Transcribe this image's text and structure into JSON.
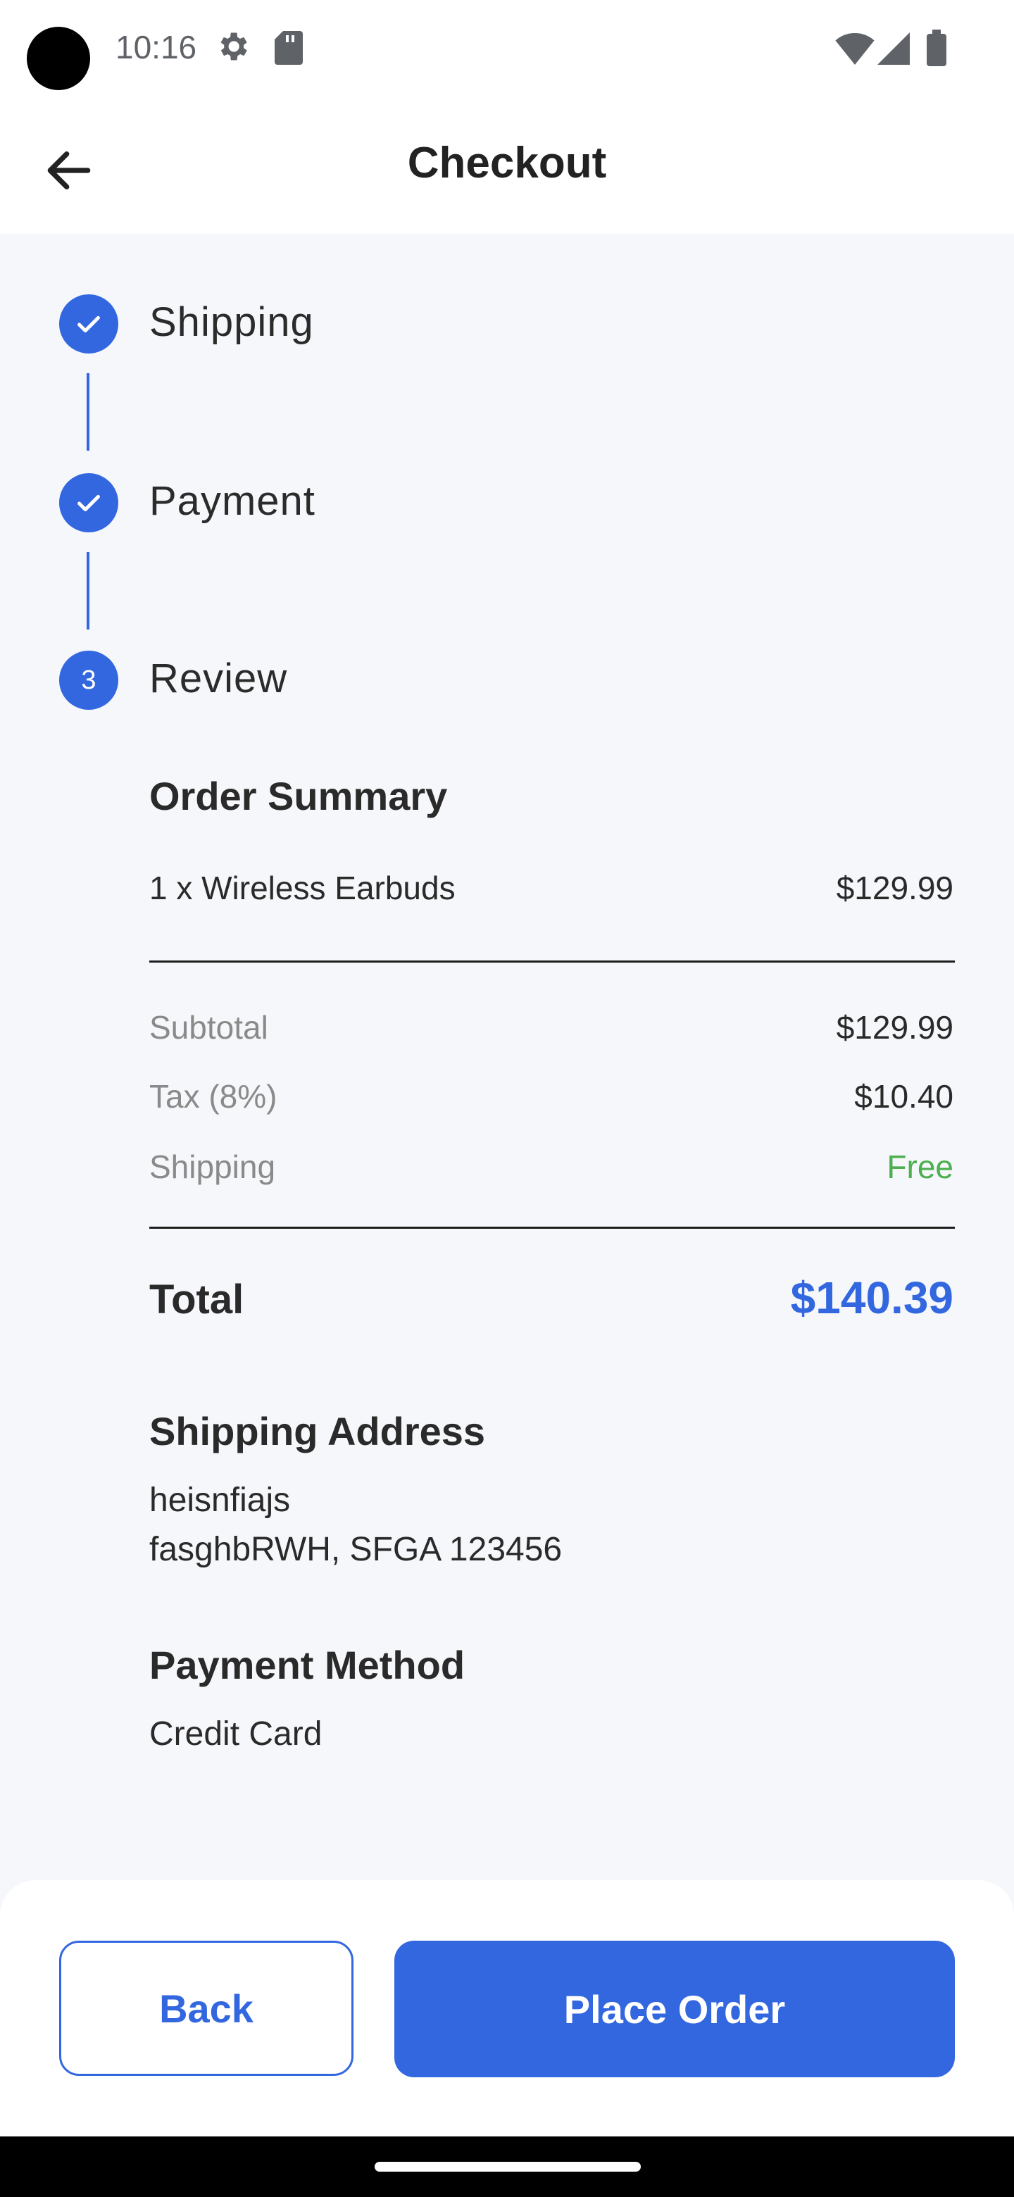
{
  "status_bar": {
    "time": "10:16",
    "icons": [
      "gear-icon",
      "sd-card-icon",
      "wifi-icon",
      "signal-icon",
      "battery-icon"
    ]
  },
  "app_bar": {
    "title": "Checkout",
    "back_icon": "arrow-left-icon"
  },
  "stepper": {
    "steps": [
      {
        "label": "Shipping",
        "state": "completed",
        "icon": "check-icon"
      },
      {
        "label": "Payment",
        "state": "completed",
        "icon": "check-icon"
      },
      {
        "label": "Review",
        "state": "active",
        "number": "3"
      }
    ]
  },
  "order_summary": {
    "heading": "Order Summary",
    "items": [
      {
        "description": "1 x Wireless Earbuds",
        "price": "$129.99"
      }
    ],
    "subtotal_label": "Subtotal",
    "subtotal_value": "$129.99",
    "tax_label": "Tax (8%)",
    "tax_value": "$10.40",
    "shipping_label": "Shipping",
    "shipping_value": "Free",
    "total_label": "Total",
    "total_value": "$140.39"
  },
  "shipping_address": {
    "heading": "Shipping Address",
    "line1": "heisnfiajs",
    "line2": "fasghbRWH, SFGA 123456"
  },
  "payment_method": {
    "heading": "Payment Method",
    "value": "Credit Card"
  },
  "actions": {
    "back_label": "Back",
    "place_order_label": "Place Order"
  },
  "colors": {
    "accent": "#3367e0",
    "free": "#4caf50",
    "background": "#f6f7fa"
  }
}
